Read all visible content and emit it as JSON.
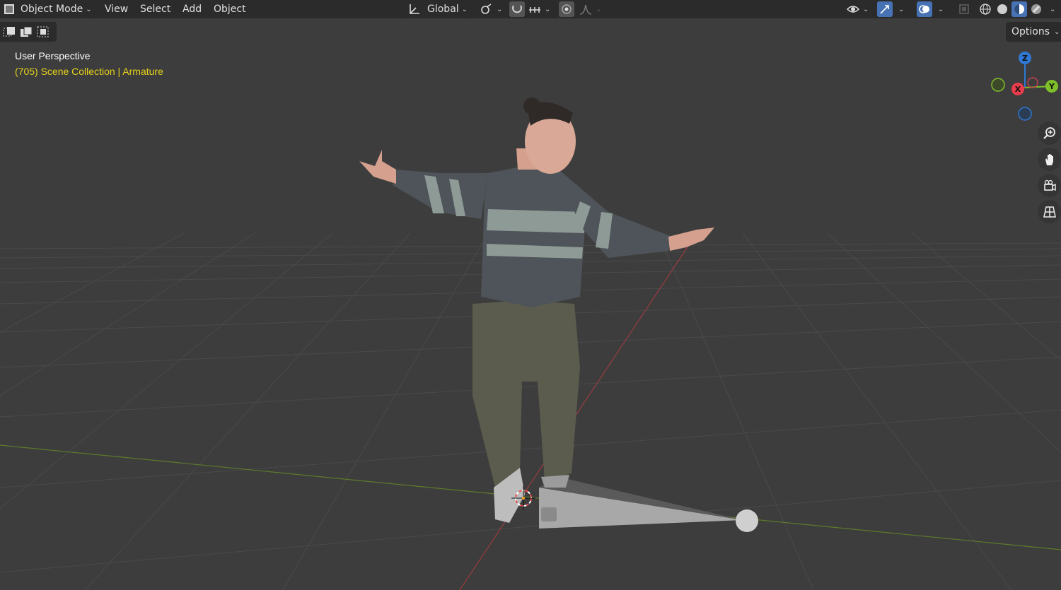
{
  "header": {
    "mode_label": "Object Mode",
    "menus": [
      "View",
      "Select",
      "Add",
      "Object"
    ],
    "orientation_label": "Global"
  },
  "options_label": "Options",
  "overlay": {
    "view_name": "User Perspective",
    "frame": "(705)",
    "collection": "Scene Collection",
    "separator": "|",
    "active_object": "Armature"
  },
  "gizmo": {
    "z_label": "Z",
    "x_label": "X",
    "y_label": "Y"
  },
  "nav_icons": [
    "zoom-icon",
    "pan-hand-icon",
    "camera-view-icon",
    "ortho-grid-icon"
  ],
  "colors": {
    "background": "#3d3d3d",
    "header": "#2b2b2b",
    "accent": "#4772b3",
    "collection_text": "#e8d31a",
    "axis_x": "#e83d4a",
    "axis_y": "#7fbf2a",
    "axis_z": "#2f78d3"
  }
}
